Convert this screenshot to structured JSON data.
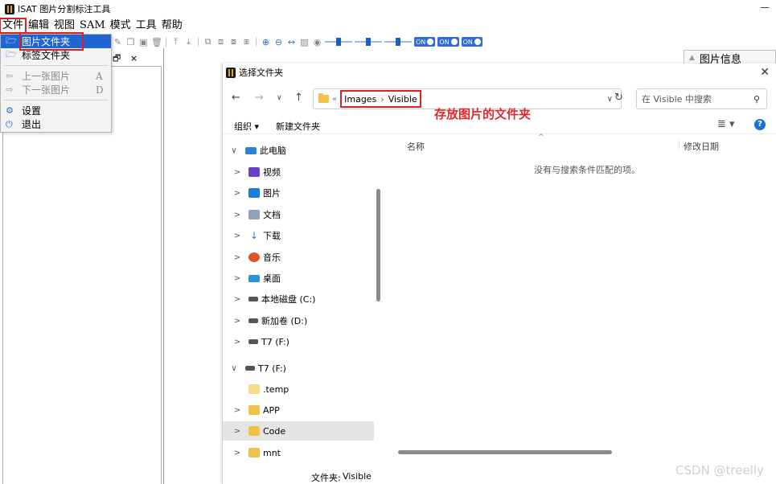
{
  "app": {
    "title": "ISAT 图片分割标注工具",
    "minimize": "—"
  },
  "menubar": [
    "文件",
    "编辑",
    "视图",
    "SAM",
    "模式",
    "工具",
    "帮助"
  ],
  "file_menu": {
    "items": [
      {
        "icon": "folder-icon",
        "label": "图片文件夹",
        "shortcut": "",
        "state": "highlighted"
      },
      {
        "icon": "folder-icon",
        "label": "标签文件夹",
        "shortcut": "",
        "state": "normal"
      },
      {
        "icon": "prev-arrow-icon",
        "label": "上一张图片",
        "shortcut": "A",
        "state": "disabled"
      },
      {
        "icon": "next-arrow-icon",
        "label": "下一张图片",
        "shortcut": "D",
        "state": "disabled"
      },
      {
        "icon": "gear-icon",
        "label": "设置",
        "shortcut": "",
        "state": "normal"
      },
      {
        "icon": "power-icon",
        "label": "退出",
        "shortcut": "",
        "state": "normal"
      }
    ]
  },
  "toolbar": {
    "toggles": [
      "ON",
      "ON",
      "ON"
    ]
  },
  "left_panel": {
    "float_icon": "🗗",
    "close_icon": "×"
  },
  "info_panel": {
    "title": "图片信息"
  },
  "dialog": {
    "title": "选择文件夹",
    "close": "✕",
    "address": {
      "more": "«",
      "crumbs": [
        "Images",
        "Visible"
      ]
    },
    "annotation": "存放图片的文件夹",
    "search_placeholder": "在 Visible 中搜索",
    "commands": {
      "organize": "组织 ▾",
      "new_folder": "新建文件夹",
      "help": "?"
    },
    "tree": [
      {
        "chev": "∨",
        "icon": "pc",
        "label": "此电脑",
        "indent": 0
      },
      {
        "chev": ">",
        "icon": "video",
        "label": "视频",
        "indent": 1
      },
      {
        "chev": ">",
        "icon": "pic",
        "label": "图片",
        "indent": 1
      },
      {
        "chev": ">",
        "icon": "doc",
        "label": "文档",
        "indent": 1
      },
      {
        "chev": ">",
        "icon": "dl",
        "label": "下载",
        "indent": 1
      },
      {
        "chev": ">",
        "icon": "music",
        "label": "音乐",
        "indent": 1
      },
      {
        "chev": ">",
        "icon": "desk",
        "label": "桌面",
        "indent": 1
      },
      {
        "chev": ">",
        "icon": "disk",
        "label": "本地磁盘 (C:)",
        "indent": 1
      },
      {
        "chev": ">",
        "icon": "disk",
        "label": "新加卷 (D:)",
        "indent": 1
      },
      {
        "chev": ">",
        "icon": "disk",
        "label": "T7 (F:)",
        "indent": 1
      },
      {
        "chev": "∨",
        "icon": "disk",
        "label": "T7 (F:)",
        "indent": 0
      },
      {
        "chev": "",
        "icon": "folder-light",
        "label": ".temp",
        "indent": 1
      },
      {
        "chev": ">",
        "icon": "folder",
        "label": "APP",
        "indent": 1
      },
      {
        "chev": ">",
        "icon": "folder",
        "label": "Code",
        "indent": 1,
        "selected": true
      },
      {
        "chev": ">",
        "icon": "folder",
        "label": "mnt",
        "indent": 1
      }
    ],
    "columns": {
      "name": "名称",
      "date": "修改日期"
    },
    "empty_message": "没有与搜索条件匹配的项。",
    "folder_field": {
      "label": "文件夹:",
      "value": "Visible"
    }
  },
  "watermark": "CSDN @treelly"
}
